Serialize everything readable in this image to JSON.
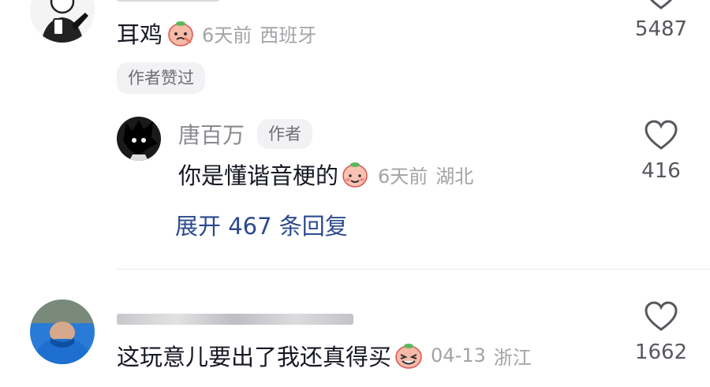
{
  "comment1": {
    "text": "耳鸡",
    "time": "6天前",
    "location": "西班牙",
    "likes": "5487",
    "author_liked_chip": "作者赞过"
  },
  "reply1": {
    "username": "唐百万",
    "author_badge": "作者",
    "text": "你是懂谐音梗的",
    "time": "6天前",
    "location": "湖北",
    "likes": "416"
  },
  "expand_replies": "展开 467 条回复",
  "comment2": {
    "text": "这玩意儿要出了我还真得买",
    "time": "04-13",
    "location": "浙江",
    "likes": "1662"
  },
  "colors": {
    "link_blue": "#2c4a8f",
    "meta_gray": "#a3a3a8",
    "chip_bg": "#f2f2f4"
  }
}
